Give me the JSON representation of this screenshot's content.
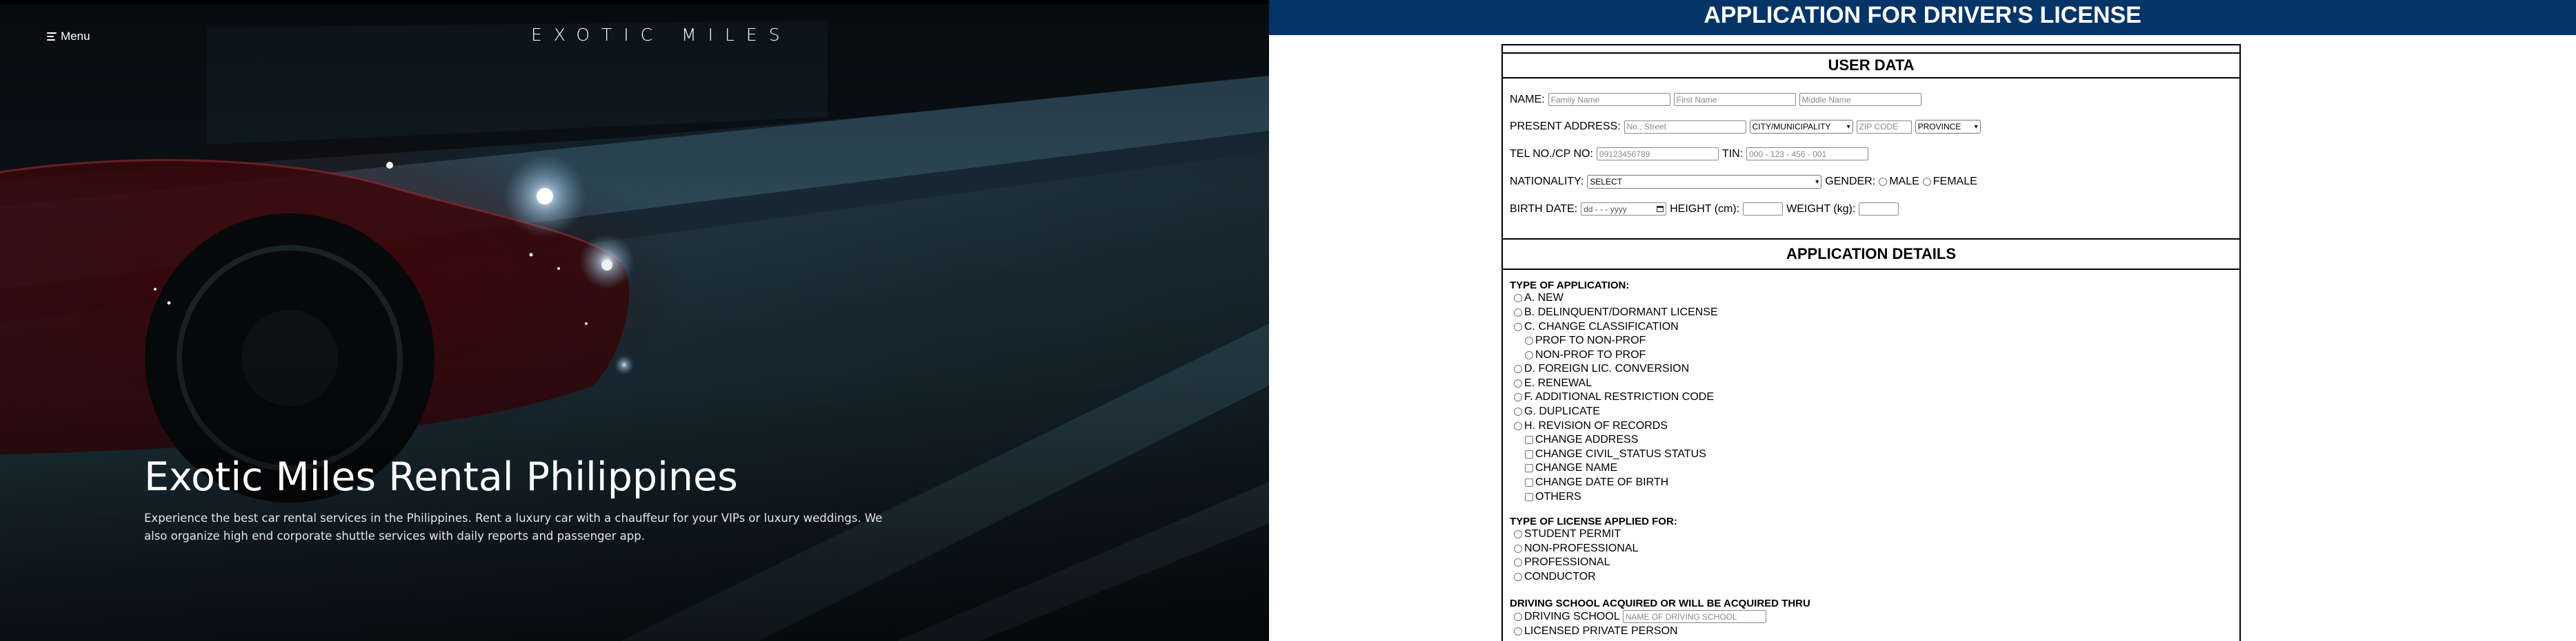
{
  "hero": {
    "menu_label": "Menu",
    "logo_text": "EXOTIC MILES",
    "title": "Exotic Miles Rental Philippines",
    "description": "Experience the best car rental services in the Philippines. Rent a luxury car with a chauffeur for your VIPs or luxury weddings. We also organize high end corporate shuttle services with daily reports and passenger app.",
    "colors": {
      "overlay": "#04070b",
      "text": "#ffffff"
    }
  },
  "form": {
    "header": "APPLICATION FOR DRIVER'S LICENSE",
    "header_color": "#043468",
    "user_data": {
      "title": "USER DATA",
      "name_label": "NAME:",
      "family_name_placeholder": "Family Name",
      "first_name_placeholder": "First Name",
      "middle_name_placeholder": "Middle Name",
      "address_label": "PRESENT ADDRESS:",
      "street_placeholder": "No., Street",
      "city_select": "CITY/MUNICIPALITY",
      "zip_placeholder": "ZIP CODE",
      "province_select": "PROVINCE",
      "tel_label": "TEL NO./CP NO:",
      "tel_placeholder": "09123456789",
      "tin_label": "TIN:",
      "tin_placeholder": "000 - 123 - 456 - 001",
      "nationality_label": "NATIONALITY:",
      "nationality_select": "SELECT",
      "gender_label": "GENDER:",
      "gender_male": "MALE",
      "gender_female": "FEMALE",
      "birth_label": "BIRTH DATE:",
      "birth_placeholder": "dd - - - yyyy",
      "height_label": "HEIGHT (cm):",
      "weight_label": "WEIGHT (kg):"
    },
    "application": {
      "title": "APPLICATION DETAILS",
      "type_title": "TYPE OF APPLICATION:",
      "types": [
        "A. NEW",
        "B. DELINQUENT/DORMANT LICENSE",
        "C. CHANGE CLASSIFICATION",
        "PROF TO NON-PROF",
        "NON-PROF TO PROF",
        "D. FOREIGN LIC. CONVERSION",
        "E. RENEWAL",
        "F. ADDITIONAL RESTRICTION CODE",
        "G. DUPLICATE",
        "H. REVISION OF RECORDS"
      ],
      "revisions": [
        "CHANGE ADDRESS",
        "CHANGE CIVIL_STATUS STATUS",
        "CHANGE NAME",
        "CHANGE DATE OF BIRTH",
        "OTHERS"
      ],
      "license_title": "TYPE OF LICENSE APPLIED FOR:",
      "licenses": [
        "STUDENT PERMIT",
        "NON-PROFESSIONAL",
        "PROFESSIONAL",
        "CONDUCTOR"
      ],
      "school_title": "DRIVING SCHOOL ACQUIRED OR WILL BE ACQUIRED THRU",
      "school_options": [
        "DRIVING SCHOOL",
        "LICENSED PRIVATE PERSON"
      ],
      "school_placeholder": "NAME OF DRIVING SCHOOL"
    }
  }
}
